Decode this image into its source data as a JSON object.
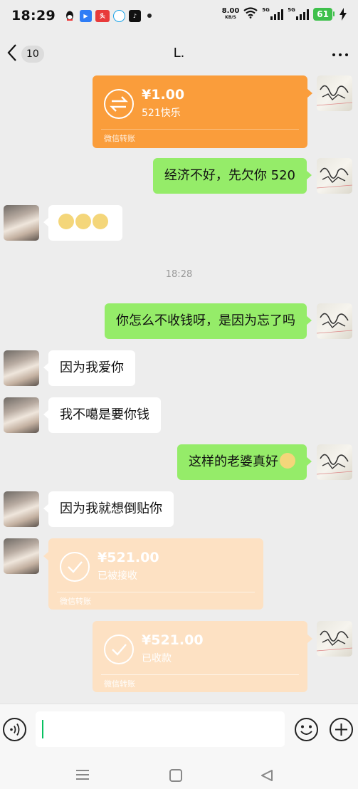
{
  "status_bar": {
    "time": "18:29",
    "net_speed": "8.00",
    "net_unit": "KB/S",
    "signal_1": "5G",
    "signal_2": "5G",
    "battery": "61"
  },
  "header": {
    "back_count": "10",
    "title": "L."
  },
  "messages": {
    "transfer_1": {
      "amount": "¥1.00",
      "note": "521快乐",
      "footer": "微信转账"
    },
    "msg_1": "经济不好，先欠你 520",
    "msg_2_emojis": [
      "cat-face",
      "cat-face",
      "cat-face"
    ],
    "timestamp": "18:28",
    "msg_3": "你怎么不收钱呀，是因为忘了吗",
    "msg_4": "因为我爱你",
    "msg_5": "我不噶是要你钱",
    "msg_6": "这样的老婆真好",
    "msg_7": "因为我就想倒贴你",
    "transfer_2": {
      "amount": "¥521.00",
      "status": "已被接收",
      "footer": "微信转账"
    },
    "transfer_3": {
      "amount": "¥521.00",
      "status": "已收款",
      "footer": "微信转账"
    }
  },
  "colors": {
    "chat_bg": "#ededed",
    "sent_bubble": "#95ec69",
    "received_bubble": "#ffffff",
    "transfer_active": "#fa9d3b",
    "transfer_done": "#fde1c3",
    "wechat_green": "#07c160"
  },
  "icons": {
    "voice": "voice-icon",
    "emoji": "emoji-icon",
    "plus": "plus-icon",
    "transfer": "transfer-arrows-icon",
    "received": "checkmark-icon"
  }
}
